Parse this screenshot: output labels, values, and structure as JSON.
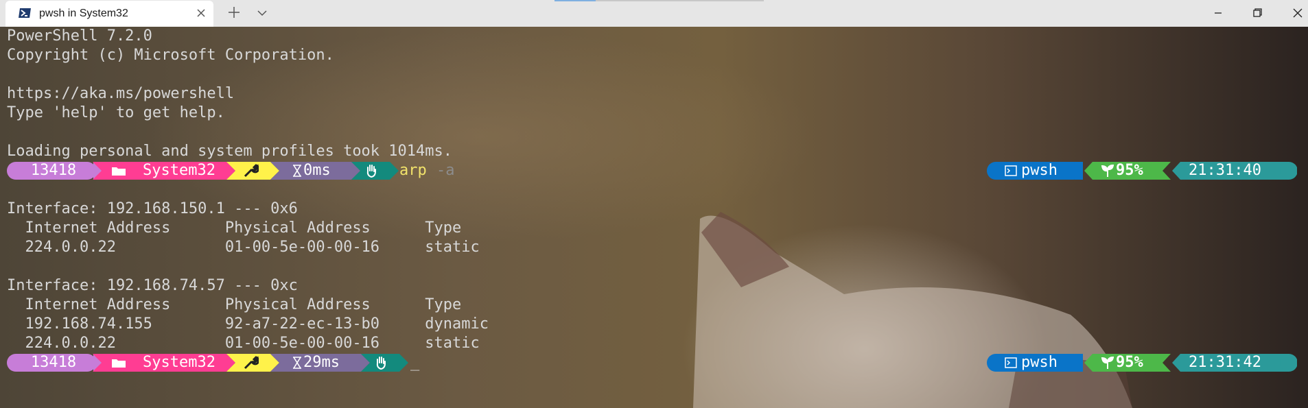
{
  "window": {
    "tab_title": "pwsh in System32",
    "tab_icon": "powershell-icon",
    "controls": [
      "minimize-icon",
      "maximize-icon",
      "close-icon"
    ]
  },
  "colors": {
    "seg_pid": "#c77dd8",
    "seg_path": "#ff3d93",
    "seg_git": "#fff24a",
    "seg_time": "#7c6c9c",
    "seg_status": "#138a7d",
    "rseg_shell": "#0a74c8",
    "rseg_battery": "#4db849",
    "rseg_clock": "#2b9a9a"
  },
  "terminal": {
    "banner": [
      "PowerShell 7.2.0",
      "Copyright (c) Microsoft Corporation.",
      "",
      "https://aka.ms/powershell",
      "Type 'help' to get help.",
      "",
      "Loading personal and system profiles took 1014ms."
    ],
    "prompt1": {
      "pid": "13418",
      "path": "System32",
      "duration": "0ms",
      "command": "arp",
      "args": "-a",
      "shell": "pwsh",
      "battery": "95%",
      "clock": "21:31:40"
    },
    "output": [
      "",
      "Interface: 192.168.150.1 --- 0x6",
      "  Internet Address      Physical Address      Type",
      "  224.0.0.22            01-00-5e-00-00-16     static",
      "",
      "Interface: 192.168.74.57 --- 0xc",
      "  Internet Address      Physical Address      Type",
      "  192.168.74.155        92-a7-22-ec-13-b0     dynamic",
      "  224.0.0.22            01-00-5e-00-00-16     static"
    ],
    "prompt2": {
      "pid": "13418",
      "path": "System32",
      "duration": "29ms",
      "shell": "pwsh",
      "battery": "95%",
      "clock": "21:31:42",
      "cursor": "_"
    }
  }
}
